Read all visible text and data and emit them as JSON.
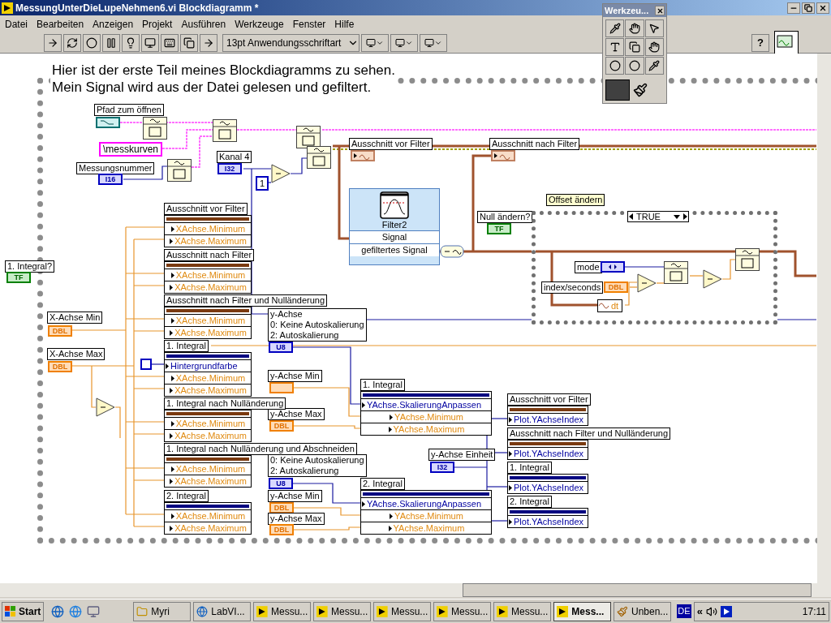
{
  "window": {
    "title": "MessungUnterDieLupeNehmen6.vi Blockdiagramm *"
  },
  "menu": [
    "Datei",
    "Bearbeiten",
    "Anzeigen",
    "Projekt",
    "Ausführen",
    "Werkzeuge",
    "Fenster",
    "Hilfe"
  ],
  "toolbar": {
    "font": "13pt Anwendungsschriftart",
    "help": "?"
  },
  "tools_palette": {
    "title": "Werkzeu..."
  },
  "comment": [
    "Hier ist der erste Teil meines Blockdiagramms zu sehen.",
    "Mein Signal wird aus der Datei gelesen und gefiltert."
  ],
  "terminals": [
    {
      "label": "Pfad zum öffnen",
      "kind": "path"
    },
    {
      "label": "Messungsnummer",
      "kind": "int",
      "type": "I16"
    },
    {
      "label": "Kanal 4",
      "kind": "int",
      "type": "I32"
    },
    {
      "label": "1. Integral?",
      "kind": "bool",
      "type": "TF"
    },
    {
      "label": "X-Achse Min",
      "kind": "dbl",
      "type": "DBL"
    },
    {
      "label": "X-Achse Max",
      "kind": "dbl",
      "type": "DBL"
    },
    {
      "label": "Null ändern?",
      "kind": "bool",
      "type": "TF"
    },
    {
      "label": "y-Achse Min",
      "kind": "dbl"
    },
    {
      "label": "y-Achse Max",
      "kind": "dbl",
      "type": "DBL"
    },
    {
      "label": "y-Achse Min",
      "kind": "dbl",
      "type": "DBL"
    },
    {
      "label": "y-Achse Max",
      "kind": "dbl",
      "type": "DBL"
    },
    {
      "label": "y-Achse Einheit",
      "kind": "int",
      "type": "I32"
    },
    {
      "label": "mode",
      "kind": "enum"
    },
    {
      "label": "index/seconds",
      "kind": "dbl",
      "type": "DBL"
    }
  ],
  "constants": [
    {
      "kind": "string",
      "value": "\\messkurven"
    },
    {
      "kind": "number",
      "value": "1"
    }
  ],
  "rings": [
    {
      "lines": [
        "y-Achse",
        "0: Keine Autoskalierung",
        "2: Autoskalierung"
      ],
      "type": "U8"
    },
    {
      "lines": [
        "0: Keine Autoskalierung",
        "2: Autoskalierung"
      ],
      "type": "U8"
    }
  ],
  "indicators": [
    {
      "label": "Ausschnitt vor Filter"
    },
    {
      "label": "Ausschnitt nach Filter"
    }
  ],
  "property_nodes": [
    {
      "label": "Ausschnitt vor Filter",
      "color": "#7a3a10",
      "rows": [
        {
          "name": "XAchse.Minimum",
          "kind": "dbl"
        },
        {
          "name": "XAchse.Maximum",
          "kind": "dbl"
        }
      ]
    },
    {
      "label": "Ausschnitt nach Filter",
      "color": "#7a3a10",
      "rows": [
        {
          "name": "XAchse.Minimum",
          "kind": "dbl"
        },
        {
          "name": "XAchse.Maximum",
          "kind": "dbl"
        }
      ]
    },
    {
      "label": "Ausschnitt nach Filter und Nulländerung",
      "color": "#7a3a10",
      "rows": [
        {
          "name": "XAchse.Minimum",
          "kind": "dbl"
        },
        {
          "name": "XAchse.Maximum",
          "kind": "dbl"
        }
      ]
    },
    {
      "label": "1. Integral",
      "color": "#000080",
      "rows": [
        {
          "name": "Hintergrundfarbe",
          "kind": "int"
        },
        {
          "name": "XAchse.Minimum",
          "kind": "dbl"
        },
        {
          "name": "XAchse.Maximum",
          "kind": "dbl"
        }
      ]
    },
    {
      "label": "1. Integral nach Nulländerung",
      "color": "#7a3a10",
      "rows": [
        {
          "name": "XAchse.Minimum",
          "kind": "dbl"
        },
        {
          "name": "XAchse.Maximum",
          "kind": "dbl"
        }
      ]
    },
    {
      "label": "1. Integral nach Nulländerung und Abschneiden",
      "color": "#7a3a10",
      "rows": [
        {
          "name": "XAchse.Minimum",
          "kind": "dbl"
        },
        {
          "name": "XAchse.Maximum",
          "kind": "dbl"
        }
      ]
    },
    {
      "label": "2. Integral",
      "color": "#000080",
      "rows": [
        {
          "name": "XAchse.Minimum",
          "kind": "dbl"
        },
        {
          "name": "XAchse.Maximum",
          "kind": "dbl"
        }
      ]
    },
    {
      "label": "1. Integral",
      "color": "#000080",
      "rows": [
        {
          "name": "YAchse.SkalierungAnpassen",
          "kind": "int"
        },
        {
          "name": "YAchse.Minimum",
          "kind": "dbl"
        },
        {
          "name": "YAchse.Maximum",
          "kind": "dbl"
        }
      ]
    },
    {
      "label": "2. Integral",
      "color": "#000080",
      "rows": [
        {
          "name": "YAchse.SkalierungAnpassen",
          "kind": "int"
        },
        {
          "name": "YAchse.Minimum",
          "kind": "dbl"
        },
        {
          "name": "YAchse.Maximum",
          "kind": "dbl"
        }
      ]
    },
    {
      "label": "Ausschnitt vor Filter",
      "color": "#7a3a10",
      "rows": [
        {
          "name": "Plot.YAchseIndex",
          "kind": "int"
        }
      ]
    },
    {
      "label": "Ausschnitt nach Filter und Nulländerung",
      "color": "#7a3a10",
      "rows": [
        {
          "name": "Plot.YAchseIndex",
          "kind": "int"
        }
      ]
    },
    {
      "label": "1. Integral",
      "color": "#000080",
      "rows": [
        {
          "name": "Plot.YAchseIndex",
          "kind": "int"
        }
      ]
    },
    {
      "label": "2. Integral",
      "color": "#000080",
      "rows": [
        {
          "name": "Plot.YAchseIndex",
          "kind": "int"
        }
      ]
    }
  ],
  "filter": {
    "title": "Filter2",
    "input": "Signal",
    "output": "gefiltertes Signal"
  },
  "case_structure": {
    "label": "Offset ändern",
    "selector": "TRUE",
    "unbundle": "dt"
  },
  "taskbar": {
    "start": "Start",
    "items": [
      {
        "label": "Myri",
        "kind": "folder",
        "selected": false
      },
      {
        "label": "LabVI...",
        "kind": "browser",
        "selected": false
      },
      {
        "label": "Messu...",
        "kind": "vi",
        "selected": false
      },
      {
        "label": "Messu...",
        "kind": "vi",
        "selected": false
      },
      {
        "label": "Messu...",
        "kind": "vi",
        "selected": false
      },
      {
        "label": "Messu...",
        "kind": "vi",
        "selected": false
      },
      {
        "label": "Messu...",
        "kind": "vi",
        "selected": false
      },
      {
        "label": "Mess...",
        "kind": "vi",
        "selected": true
      },
      {
        "label": "Unben...",
        "kind": "paint",
        "selected": false
      }
    ],
    "language": "DE",
    "tray_toggle": "«",
    "clock": "17:11"
  }
}
